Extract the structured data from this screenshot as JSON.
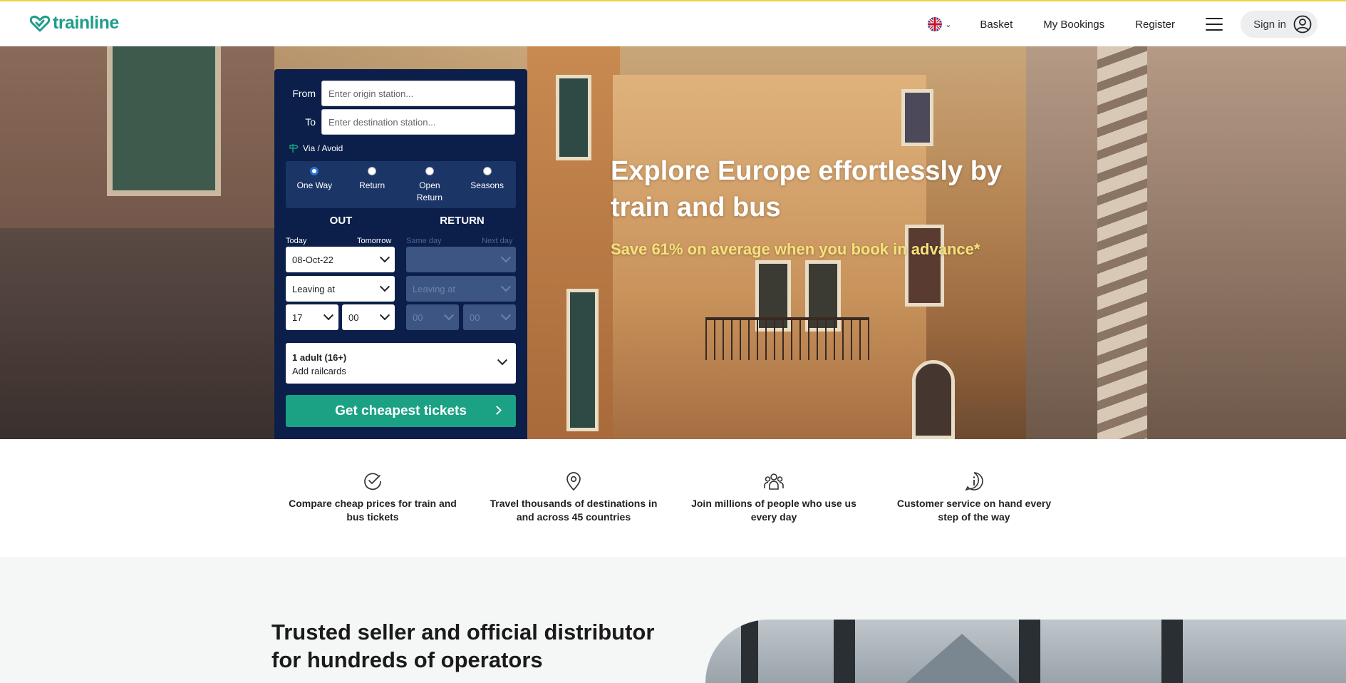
{
  "header": {
    "logo_text": "trainline",
    "language": "English (UK)",
    "nav": [
      "Basket",
      "My Bookings",
      "Register"
    ],
    "signin_label": "Sign in"
  },
  "hero": {
    "title": "Explore Europe effortlessly by train and bus",
    "subtitle": "Save 61% on average when you book in advance*"
  },
  "search": {
    "from_label": "From",
    "from_placeholder": "Enter origin station...",
    "to_label": "To",
    "to_placeholder": "Enter destination station...",
    "via_label": "Via / Avoid",
    "journey_types": [
      {
        "label": "One Way",
        "selected": true
      },
      {
        "label": "Return",
        "selected": false
      },
      {
        "label": "Open Return",
        "selected": false
      },
      {
        "label": "Seasons",
        "selected": false
      }
    ],
    "out": {
      "heading": "OUT",
      "today": "Today",
      "tomorrow": "Tomorrow",
      "date": "08-Oct-22",
      "time_mode": "Leaving at",
      "hour": "17",
      "minute": "00"
    },
    "return": {
      "heading": "RETURN",
      "same_day": "Same day",
      "next_day": "Next day",
      "date": "",
      "time_mode": "Leaving at",
      "hour": "00",
      "minute": "00"
    },
    "passengers": "1 adult (16+)",
    "railcards": "Add railcards",
    "cta": "Get cheapest tickets"
  },
  "features": [
    {
      "icon": "check-circle-icon",
      "text": "Compare cheap prices for train and bus tickets"
    },
    {
      "icon": "map-pin-icon",
      "text": "Travel thousands of destinations in and across 45 countries"
    },
    {
      "icon": "people-icon",
      "text": "Join millions of people who use us every day"
    },
    {
      "icon": "info-bubble-icon",
      "text": "Customer service on hand every step of the way"
    }
  ],
  "trusted": {
    "heading": "Trusted seller and official distributor for hundreds of operators"
  },
  "colors": {
    "brand": "#1f9d8a",
    "widget": "#0b1f4a",
    "cta": "#1ba184",
    "hero_subtitle": "#f6e27a"
  }
}
